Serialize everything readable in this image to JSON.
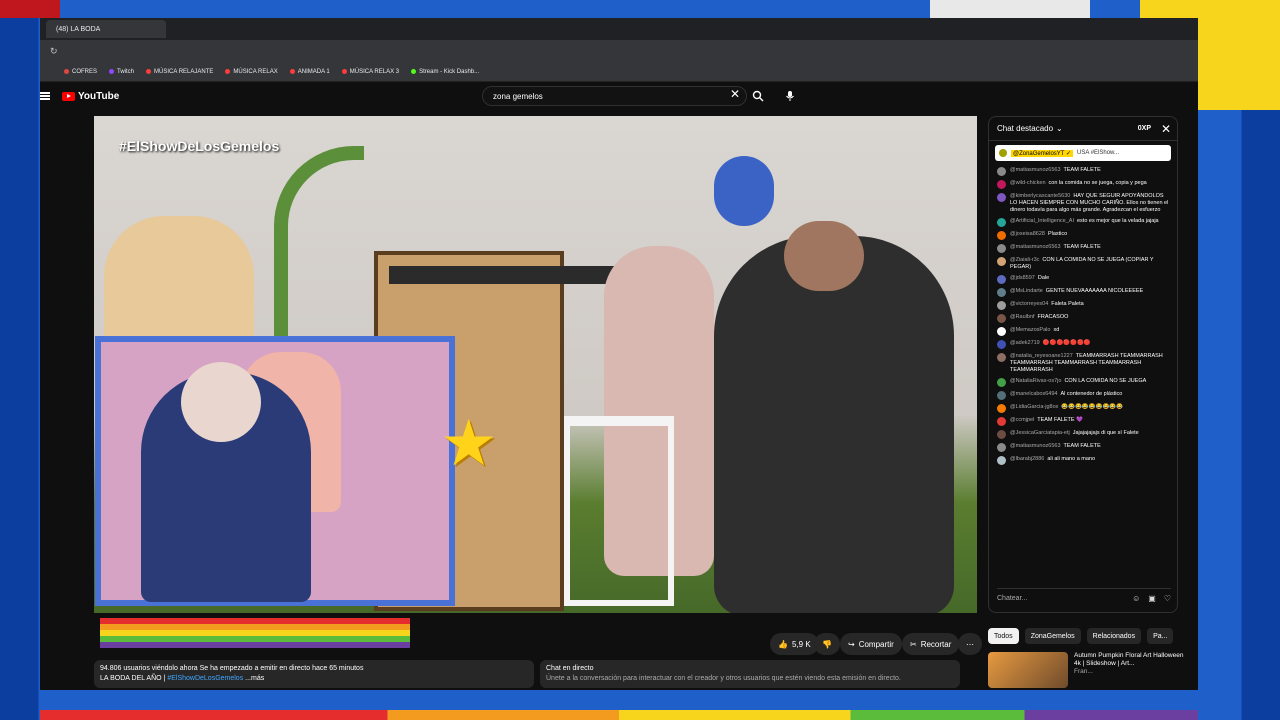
{
  "browser": {
    "tab_title": "(48) LA BODA",
    "bookmarks": [
      {
        "label": "COFRES",
        "color": "#e0483f"
      },
      {
        "label": "Twitch",
        "color": "#9146ff"
      },
      {
        "label": "MÚSICA RELAJANTE",
        "color": "#ff3d3d"
      },
      {
        "label": "MÚSICA RELAX",
        "color": "#ff3d3d"
      },
      {
        "label": "ANIMADA 1",
        "color": "#ff3d3d"
      },
      {
        "label": "MÚSICA RELAX 3",
        "color": "#ff3d3d"
      },
      {
        "label": "Stream - Kick Dashb...",
        "color": "#53fc18"
      }
    ]
  },
  "youtube": {
    "logo_text": "YouTube",
    "search_query": "zona gemelos"
  },
  "video": {
    "hashtag": "#ElShowDeLosGemelos"
  },
  "actions": {
    "like_count": "5,9 K",
    "share_label": "Compartir",
    "clip_label": "Recortar"
  },
  "description": {
    "line1": "94.806 usuarios viéndolo ahora  Se ha empezado a emitir en directo hace 65 minutos",
    "line2_prefix": "LA BODA DEL AÑO |",
    "line2_tag": "#ElShowDeLosGemelos",
    "line2_more": "...más"
  },
  "chat_promo": {
    "title": "Chat en directo",
    "subtitle": "Únete a la conversación para interactuar con el creador y otros usuarios que estén viendo esta emisión en directo."
  },
  "chat": {
    "header_title": "Chat destacado",
    "xp": "0XP",
    "pinned_name": "@ZonaGemelosYT ✓",
    "pinned_text": "USA #ElShow...",
    "input_placeholder": "Chatear...",
    "messages": [
      {
        "author": "@matiasmunoz6563",
        "text": "TEAM FALETE",
        "color": "#8a8a8a"
      },
      {
        "author": "@wild-chicken",
        "text": "con la comida no se juega, copia y pega",
        "color": "#c2185b"
      },
      {
        "author": "@kimberlycascante5630",
        "text": "HAY QUE SEGUIR APOYÁNDOLOS LO HACEN SIEMPRE CON MUCHO CARIÑO. Ellos no tienen el dinero todavía para algo más grande. Agradezcan el esfuerzo",
        "color": "#7e57c2"
      },
      {
        "author": "@Artificial_Intelligence_AI",
        "text": "esto es mejor que la velada jajaja",
        "color": "#26a69a"
      },
      {
        "author": "@joseisa8628",
        "text": "Plastico",
        "color": "#ef6c00"
      },
      {
        "author": "@matiasmunoz6563",
        "text": "TEAM FALETE",
        "color": "#8a8a8a"
      },
      {
        "author": "@Ziaiali-r3c",
        "text": "CON LA COMIDA NO SE JUEGA (COPIAR Y PEGAR)",
        "color": "#d4a373"
      },
      {
        "author": "@jds8597",
        "text": "Dale",
        "color": "#5c6bc0"
      },
      {
        "author": "@MsLindarte",
        "text": "GENTE NUEVAAAAAAA NICOLEEEEE",
        "color": "#607d8b"
      },
      {
        "author": "@victorreyes04",
        "text": "Faleta Paleta",
        "color": "#9e9e9e"
      },
      {
        "author": "@Raulbnf",
        "text": "FRACASOO",
        "color": "#795548"
      },
      {
        "author": "@MemazosPalo",
        "text": "xd",
        "color": "#ffffff"
      },
      {
        "author": "@adek2719",
        "text": "🔴🔴🔴🔴🔴🔴🔴",
        "color": "#3f51b5"
      },
      {
        "author": "@natalia_reyesoane1227",
        "text": "TEAMMARRASH TEAMMARRASH TEAMMARRASH TEAMMARRASH TEAMMARRASH TEAMMARRASH",
        "color": "#8d6e63"
      },
      {
        "author": "@NataliaRivas-os7jo",
        "text": "CON LA COMIDA NO SE JUEGA",
        "color": "#43a047"
      },
      {
        "author": "@manelcabos6494",
        "text": "Al contenedor de plástico",
        "color": "#546e7a"
      },
      {
        "author": "@LidiaGarcia-jg8ox",
        "text": "😂😂😂😂😂😂😂😂😂",
        "color": "#f57c00"
      },
      {
        "author": "@ccmjpel",
        "text": "TEAM FALETE 💜",
        "color": "#e53935"
      },
      {
        "author": "@JessicaGarciatapia-etj",
        "text": "Jajajajajajs di que sí Falete",
        "color": "#6d4c41"
      },
      {
        "author": "@matiasmunoz6563",
        "text": "TEAM FALETE",
        "color": "#8a8a8a"
      },
      {
        "author": "@lbarabj2886",
        "text": "ali ali mano a mano",
        "color": "#b0bec5"
      }
    ]
  },
  "chips": [
    "Todos",
    "ZonaGemelos",
    "Relacionados",
    "Pa..."
  ],
  "related": {
    "title": "Autumn Pumpkin Floral Art Halloween 4k | Slideshow | Art...",
    "channel": "Fran..."
  },
  "colors": {
    "accent_red": "#ff0000",
    "frame_blue": "#1f5fc9",
    "star_yellow": "#ffd31a"
  }
}
